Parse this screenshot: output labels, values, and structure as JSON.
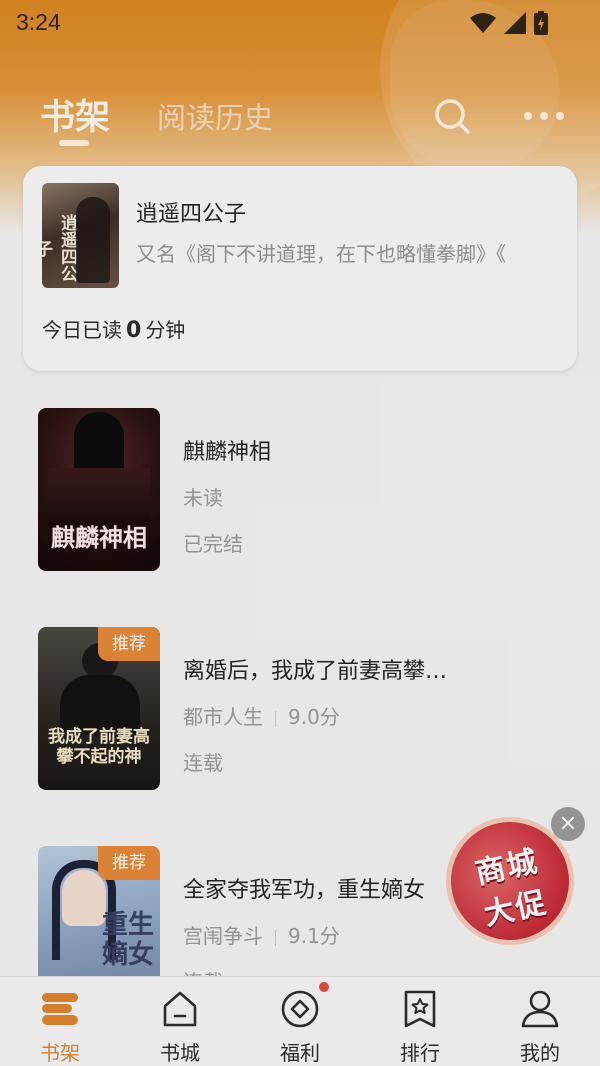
{
  "status_bar": {
    "time": "3:24"
  },
  "header": {
    "tabs": [
      {
        "label": "书架",
        "active": true
      },
      {
        "label": "阅读历史",
        "active": false
      }
    ],
    "search_icon": "search-icon",
    "more_icon": "more-icon"
  },
  "recent": {
    "title": "逍遥四公子",
    "alias": "又名《阁下不讲道理，在下也略懂拳脚》《",
    "today_prefix": "今日已读",
    "today_minutes": "0",
    "today_suffix": "分钟",
    "cover_text": "逍遥四公子"
  },
  "books": [
    {
      "title": "麒麟神相",
      "line2": "未读",
      "line3": "已完结",
      "badge": "",
      "cover_text": "麒麟神相"
    },
    {
      "title": "离婚后，我成了前妻高攀…",
      "genre": "都市人生",
      "score": "9.0分",
      "line3": "连载",
      "badge": "推荐",
      "cover_text": "我成了前妻高攀不起的神"
    },
    {
      "title": "全家夺我军功，重生嫡女",
      "genre": "宫闱争斗",
      "score": "9.1分",
      "line3": "连载",
      "badge": "推荐",
      "cover_text": "重生嫡女"
    }
  ],
  "promo": {
    "line1": "商城",
    "line2": "大促",
    "close": "×"
  },
  "bottom_nav": [
    {
      "label": "书架",
      "icon": "bookshelf-icon",
      "active": true
    },
    {
      "label": "书城",
      "icon": "bookstore-icon",
      "active": false
    },
    {
      "label": "福利",
      "icon": "welfare-icon",
      "active": false,
      "has_dot": true
    },
    {
      "label": "排行",
      "icon": "ranking-icon",
      "active": false
    },
    {
      "label": "我的",
      "icon": "profile-icon",
      "active": false
    }
  ],
  "colors": {
    "accent": "#de8530",
    "badge": "#e4883a",
    "promo": "#c72f3a"
  }
}
